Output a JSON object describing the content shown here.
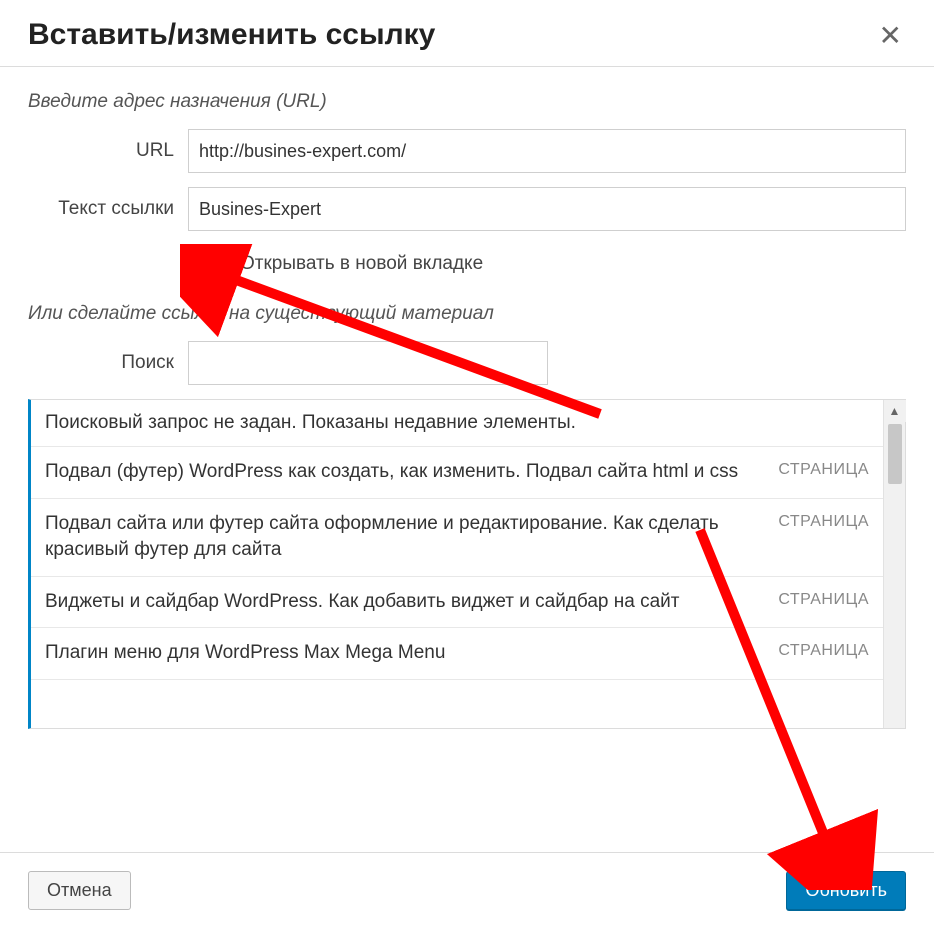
{
  "header": {
    "title": "Вставить/изменить ссылку"
  },
  "form": {
    "hint": "Введите адрес назначения (URL)",
    "url_label": "URL",
    "url_value": "http://busines-expert.com/",
    "text_label": "Текст ссылки",
    "text_value": "Busines-Expert",
    "open_new_tab_label": "Открывать в новой вкладке",
    "or_hint": "Или сделайте ссылку на существующий материал",
    "search_label": "Поиск",
    "search_value": ""
  },
  "list": {
    "message": "Поисковый запрос не задан. Показаны недавние элементы.",
    "items": [
      {
        "title": "Подвал (футер) WordPress как создать, как изменить. Подвал сайта html и css",
        "type": "СТРАНИЦА"
      },
      {
        "title": "Подвал сайта или футер сайта оформление и редактирование. Как сделать красивый футер для сайта",
        "type": "СТРАНИЦА"
      },
      {
        "title": "Виджеты и сайдбар WordPress. Как добавить виджет и сайдбар на сайт",
        "type": "СТРАНИЦА"
      },
      {
        "title": "Плагин меню для WordPress Max Mega Menu",
        "type": "СТРАНИЦА"
      }
    ]
  },
  "buttons": {
    "cancel": "Отмена",
    "submit": "Обновить"
  }
}
